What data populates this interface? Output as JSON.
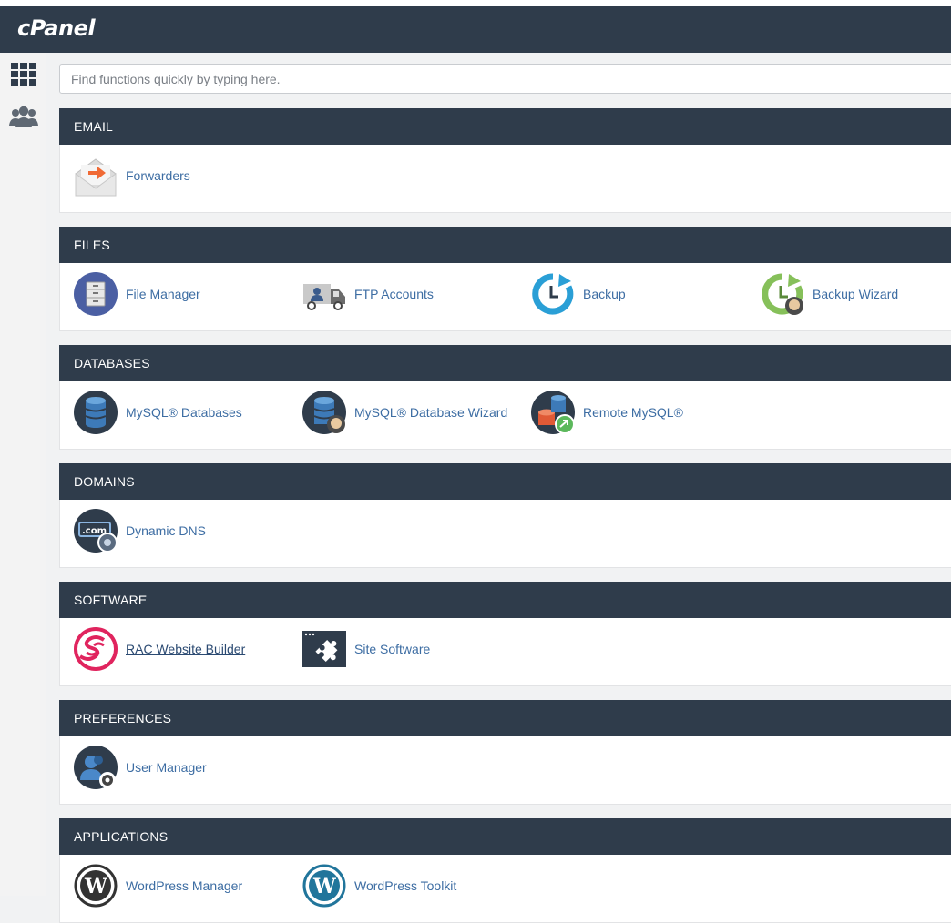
{
  "header": {
    "logo": "cPanel"
  },
  "sidebar": {
    "items": [
      {
        "icon": "grid-icon"
      },
      {
        "icon": "users-icon"
      }
    ]
  },
  "search": {
    "placeholder": "Find functions quickly by typing here."
  },
  "sections": [
    {
      "title": "EMAIL",
      "items": [
        {
          "label": "Forwarders",
          "icon": "forwarders-icon"
        }
      ]
    },
    {
      "title": "FILES",
      "items": [
        {
          "label": "File Manager",
          "icon": "file-manager-icon"
        },
        {
          "label": "FTP Accounts",
          "icon": "ftp-accounts-icon"
        },
        {
          "label": "Backup",
          "icon": "backup-icon"
        },
        {
          "label": "Backup Wizard",
          "icon": "backup-wizard-icon"
        }
      ]
    },
    {
      "title": "DATABASES",
      "items": [
        {
          "label": "MySQL® Databases",
          "icon": "mysql-databases-icon"
        },
        {
          "label": "MySQL® Database Wizard",
          "icon": "mysql-wizard-icon"
        },
        {
          "label": "Remote MySQL®",
          "icon": "remote-mysql-icon"
        }
      ]
    },
    {
      "title": "DOMAINS",
      "items": [
        {
          "label": "Dynamic DNS",
          "icon": "dynamic-dns-icon"
        }
      ]
    },
    {
      "title": "SOFTWARE",
      "items": [
        {
          "label": "RAC Website Builder",
          "icon": "website-builder-icon"
        },
        {
          "label": "Site Software",
          "icon": "site-software-icon"
        }
      ]
    },
    {
      "title": "PREFERENCES",
      "items": [
        {
          "label": "User Manager",
          "icon": "user-manager-icon"
        }
      ]
    },
    {
      "title": "APPLICATIONS",
      "items": [
        {
          "label": "WordPress Manager",
          "icon": "wordpress-icon"
        },
        {
          "label": "WordPress Toolkit",
          "icon": "wordpress-icon"
        }
      ]
    }
  ],
  "colors": {
    "header": "#2f3c4b",
    "link": "#3d6da3",
    "accent_orange": "#f06a35",
    "accent_blue": "#2a9fd6",
    "accent_green": "#86c05a"
  }
}
